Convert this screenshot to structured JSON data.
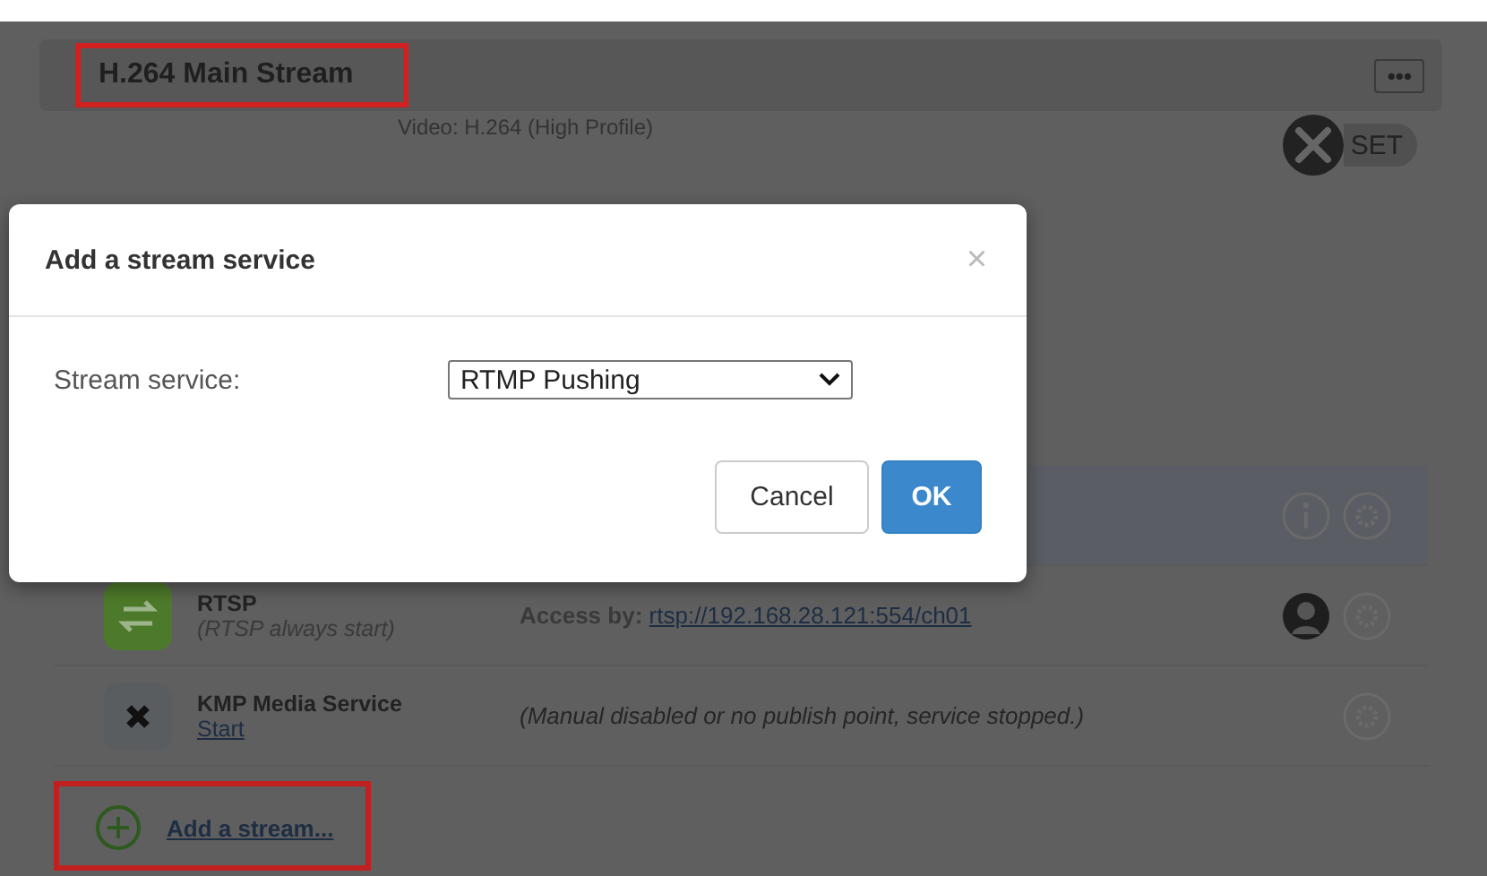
{
  "panel": {
    "title": "H.264 Main Stream",
    "title_highlighted": true,
    "menu_button": "•••",
    "video_info": "Video: H.264 (High Profile)",
    "set_button": "SET"
  },
  "services": [
    {
      "kind": "hidden"
    },
    {
      "kind": "rtsp",
      "name": "RTSP",
      "note": "(RTSP always start)",
      "access_label": "Access by:",
      "access_url": "rtsp://192.168.28.121:554/ch01"
    },
    {
      "kind": "stopped",
      "name": "KMP Media Service",
      "link": "Start",
      "message": "(Manual disabled or no publish point, service stopped.)"
    }
  ],
  "add_stream": {
    "label": "Add a stream...",
    "highlighted": true
  },
  "dialog": {
    "title": "Add a stream service",
    "close": "×",
    "field_label": "Stream service:",
    "value": "RTMP Pushing",
    "buttons": [
      {
        "label": "Cancel",
        "kind": "default"
      },
      {
        "label": "OK",
        "kind": "primary"
      }
    ]
  }
}
